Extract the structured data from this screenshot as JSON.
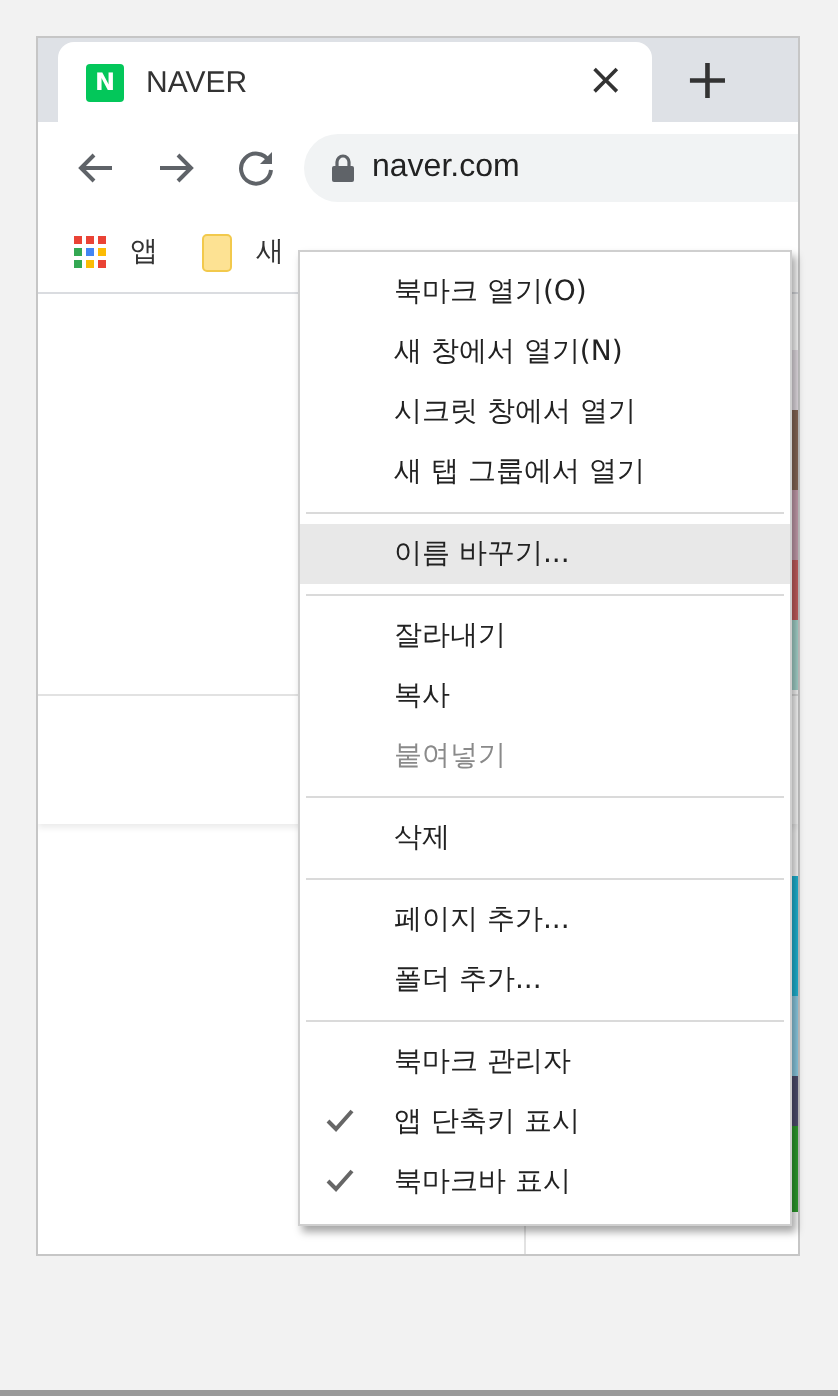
{
  "tab": {
    "favicon": "N",
    "title": "NAVER",
    "close": "×",
    "selected": true
  },
  "new_tab": "+",
  "address": {
    "url": "naver.com"
  },
  "bookmarks": [
    {
      "kind": "apps",
      "label": "앱"
    },
    {
      "kind": "folder",
      "label": "새"
    }
  ],
  "menu": {
    "items": [
      {
        "kind": "item",
        "label": "북마크 열기(O)",
        "highlighted": false,
        "disabled": false,
        "checked": false
      },
      {
        "kind": "item",
        "label": "새 창에서 열기(N)",
        "highlighted": false,
        "disabled": false,
        "checked": false
      },
      {
        "kind": "item",
        "label": "시크릿 창에서 열기",
        "highlighted": false,
        "disabled": false,
        "checked": false
      },
      {
        "kind": "item",
        "label": "새 탭 그룹에서 열기",
        "highlighted": false,
        "disabled": false,
        "checked": false
      },
      {
        "kind": "separator"
      },
      {
        "kind": "item",
        "label": "이름 바꾸기...",
        "highlighted": true,
        "disabled": false,
        "checked": false
      },
      {
        "kind": "separator"
      },
      {
        "kind": "item",
        "label": "잘라내기",
        "highlighted": false,
        "disabled": false,
        "checked": false
      },
      {
        "kind": "item",
        "label": "복사",
        "highlighted": false,
        "disabled": false,
        "checked": false
      },
      {
        "kind": "item",
        "label": "붙여넣기",
        "highlighted": false,
        "disabled": true,
        "checked": false
      },
      {
        "kind": "separator"
      },
      {
        "kind": "item",
        "label": "삭제",
        "highlighted": false,
        "disabled": false,
        "checked": false
      },
      {
        "kind": "separator"
      },
      {
        "kind": "item",
        "label": "페이지 추가...",
        "highlighted": false,
        "disabled": false,
        "checked": false
      },
      {
        "kind": "item",
        "label": "폴더 추가...",
        "highlighted": false,
        "disabled": false,
        "checked": false
      },
      {
        "kind": "separator"
      },
      {
        "kind": "item",
        "label": "북마크 관리자",
        "highlighted": false,
        "disabled": false,
        "checked": false
      },
      {
        "kind": "item",
        "label": "앱 단축키 표시",
        "highlighted": false,
        "disabled": false,
        "checked": true
      },
      {
        "kind": "item",
        "label": "북마크바 표시",
        "highlighted": false,
        "disabled": false,
        "checked": true
      }
    ]
  }
}
